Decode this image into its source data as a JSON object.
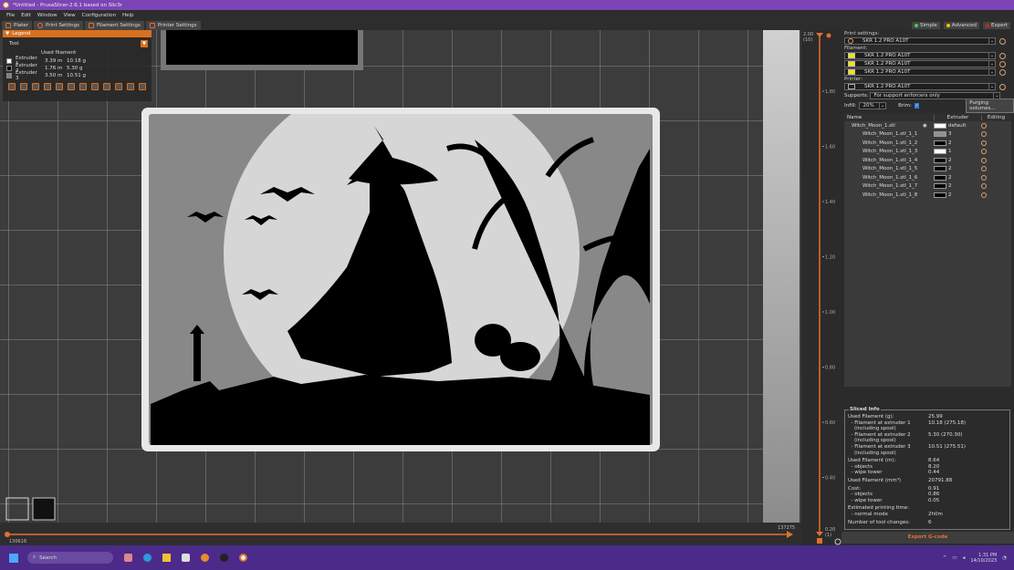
{
  "window": {
    "title": "*Untitled - PrusaSlicer-2.6.1 based on Slic3r"
  },
  "menu": [
    "File",
    "Edit",
    "Window",
    "View",
    "Configuration",
    "Help"
  ],
  "tabs": [
    "Plater",
    "Print Settings",
    "Filament Settings",
    "Printer Settings"
  ],
  "modes": [
    {
      "label": "Simple",
      "color": "#44cc44"
    },
    {
      "label": "Advanced",
      "color": "#e8c800"
    },
    {
      "label": "Expert",
      "color": "#cc2222"
    }
  ],
  "legend": {
    "title": "Legend",
    "view_type": "Tool",
    "column": "Used filament",
    "rows": [
      {
        "name": "Extruder 1",
        "m": "3.39 m",
        "g": "10.18 g",
        "color": "#ffffff"
      },
      {
        "name": "Extruder 2",
        "m": "1.76 m",
        "g": "5.30 g",
        "color": "#000000"
      },
      {
        "name": "Extruder 3",
        "m": "3.50 m",
        "g": "10.51 g",
        "color": "#808080"
      }
    ]
  },
  "vslider": {
    "top": "2.00",
    "top_layer": "(10)",
    "ticks": [
      "1.80",
      "1.60",
      "1.40",
      "1.20",
      "1.00",
      "0.80",
      "0.60",
      "0.40"
    ],
    "bottom": "0.20",
    "bottom_layer": "(1)"
  },
  "hslider": {
    "left": "130618",
    "right": "137275"
  },
  "panel": {
    "print_label": "Print settings:",
    "print_value": "SKR 1.2 PRO A10T",
    "filament_label": "Filament:",
    "filaments": [
      "SKR 1.2 PRO A10T",
      "SKR 1.2 PRO A10T",
      "SKR 1.2 PRO A10T"
    ],
    "printer_label": "Printer:",
    "printer_value": "SKR 1.2 PRO A10T",
    "supports_label": "Supports:",
    "supports_value": "For support enforcers only",
    "infill_label": "Infill:",
    "infill_value": "20%",
    "brim_label": "Brim:",
    "brim_checked": true,
    "purging_button": "Purging volumes...",
    "columns": [
      "Name",
      "Extruder",
      "Editing"
    ],
    "objects": [
      {
        "name": "Witch_Moon_1.stl",
        "extruder": "default",
        "color": "#ffffff"
      },
      {
        "name": "Witch_Moon_1.stl_1_1",
        "extruder": "3",
        "color": "#909090"
      },
      {
        "name": "Witch_Moon_1.stl_1_2",
        "extruder": "2",
        "color": "#000000"
      },
      {
        "name": "Witch_Moon_1.stl_1_3",
        "extruder": "1",
        "color": "#ffffff"
      },
      {
        "name": "Witch_Moon_1.stl_1_4",
        "extruder": "2",
        "color": "#000000"
      },
      {
        "name": "Witch_Moon_1.stl_1_5",
        "extruder": "2",
        "color": "#000000"
      },
      {
        "name": "Witch_Moon_1.stl_1_6",
        "extruder": "2",
        "color": "#000000"
      },
      {
        "name": "Witch_Moon_1.stl_1_7",
        "extruder": "2",
        "color": "#000000"
      },
      {
        "name": "Witch_Moon_1.stl_1_8",
        "extruder": "2",
        "color": "#000000"
      }
    ]
  },
  "sliced": {
    "title": "Sliced Info",
    "rows": [
      [
        "Used Filament (g):",
        "25.99"
      ],
      [
        "  - Filament at extruder 1",
        "10.18 (275.18)"
      ],
      [
        "    (including spool)",
        ""
      ],
      [
        "  - Filament at extruder 2",
        "5.30 (270.30)"
      ],
      [
        "    (including spool)",
        ""
      ],
      [
        "  - Filament at extruder 3",
        "10.51 (275.51)"
      ],
      [
        "    (including spool)",
        ""
      ],
      [
        "Used Filament (m):",
        "8.64"
      ],
      [
        "  - objects",
        "8.20"
      ],
      [
        "  - wipe tower",
        "0.44"
      ],
      [
        "Used Filament (mm³)",
        "20791.88"
      ],
      [
        "Cost:",
        "0.91"
      ],
      [
        "  - objects",
        "0.86"
      ],
      [
        "  - wipe tower",
        "0.05"
      ],
      [
        "Estimated printing time:",
        ""
      ],
      [
        "  - normal mode",
        "2h0m"
      ],
      [
        "Number of tool changes:",
        "6"
      ]
    ]
  },
  "export_button": "Export G-code",
  "taskbar": {
    "search": "Search",
    "time": "1:31 PM",
    "date": "14/10/2023"
  }
}
